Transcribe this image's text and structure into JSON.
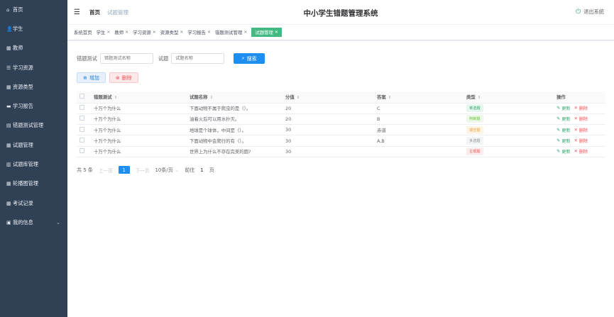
{
  "header": {
    "breadcrumb_home": "首页",
    "breadcrumb_current": "试题管理",
    "system_title": "中小学生错题管理系统",
    "logout_label": "退出系统"
  },
  "sidebar": {
    "items": [
      {
        "icon": "home-icon",
        "glyph": "⌂",
        "label": "首页"
      },
      {
        "icon": "user-icon",
        "glyph": "👤",
        "label": "学生"
      },
      {
        "icon": "grid-icon",
        "glyph": "▦",
        "label": "教师"
      },
      {
        "icon": "list-icon",
        "glyph": "☰",
        "label": "学习资源"
      },
      {
        "icon": "grid-icon",
        "glyph": "▦",
        "label": "资源类型"
      },
      {
        "icon": "video-icon",
        "glyph": "▬",
        "label": "学习报告"
      },
      {
        "icon": "archive-icon",
        "glyph": "▤",
        "label": "错题测试管理"
      },
      {
        "icon": "grid-icon",
        "glyph": "▦",
        "label": "试题管理"
      },
      {
        "icon": "chart-icon",
        "glyph": "▥",
        "label": "试题库管理"
      },
      {
        "icon": "grid-icon",
        "glyph": "▦",
        "label": "轮播图管理"
      },
      {
        "icon": "grid-icon",
        "glyph": "▦",
        "label": "考试记录"
      },
      {
        "icon": "calendar-icon",
        "glyph": "▣",
        "label": "我的信息"
      }
    ]
  },
  "tags": [
    {
      "label": "系统首页",
      "closable": false,
      "active": false
    },
    {
      "label": "学生",
      "closable": true,
      "active": false
    },
    {
      "label": "教师",
      "closable": true,
      "active": false
    },
    {
      "label": "学习资源",
      "closable": true,
      "active": false
    },
    {
      "label": "资源类型",
      "closable": true,
      "active": false
    },
    {
      "label": "学习报告",
      "closable": true,
      "active": false
    },
    {
      "label": "错题测试管理",
      "closable": true,
      "active": false
    },
    {
      "label": "试题管理",
      "closable": true,
      "active": true
    }
  ],
  "search": {
    "label1": "错题测试",
    "placeholder1": "错题测试名称",
    "label2": "试题",
    "placeholder2": "试题名称",
    "button": "搜索"
  },
  "actions": {
    "add": "增加",
    "delete": "删除"
  },
  "table": {
    "columns": [
      "错题测试",
      "试题名称",
      "分值",
      "答案",
      "类型",
      "操作"
    ],
    "rows": [
      {
        "test": "十万个为什么",
        "name": "下面动物不属于爬虫的是（）。",
        "score": "20",
        "answer": "C",
        "type": "单选题",
        "type_color": "#2ea56d",
        "type_bg": "#e6f6ee"
      },
      {
        "test": "十万个为什么",
        "name": "油着火后可以用水扑灭。",
        "score": "20",
        "answer": "B",
        "type": "判断题",
        "type_color": "#67c23a",
        "type_bg": "#eef8e8"
      },
      {
        "test": "十万个为什么",
        "name": "地球是个球体，中间是（）。",
        "score": "30",
        "answer": "赤道",
        "type": "填空题",
        "type_color": "#e6a23c",
        "type_bg": "#fdf4e6"
      },
      {
        "test": "十万个为什么",
        "name": "下面动物中会爬行的有（）。",
        "score": "30",
        "answer": "A,B",
        "type": "多选题",
        "type_color": "#909399",
        "type_bg": "#f3f4f5"
      },
      {
        "test": "十万个为什么",
        "name": "世界上为什么不存在完美的圆?",
        "score": "30",
        "answer": "",
        "type": "主观题",
        "type_color": "#e9535c",
        "type_bg": "#fdecec"
      }
    ],
    "edit_label": "更新",
    "delete_label": "删除"
  },
  "pagination": {
    "total": "共 5 条",
    "prev": "上一页",
    "current": "1",
    "next": "下一页",
    "page_size": "10条/页",
    "goto_label": "前往",
    "goto_value": "1",
    "goto_suffix": "页"
  },
  "colors": {
    "sidebar_bg": "#304156",
    "primary": "#1f8ef1",
    "active_tag": "#42b983"
  }
}
